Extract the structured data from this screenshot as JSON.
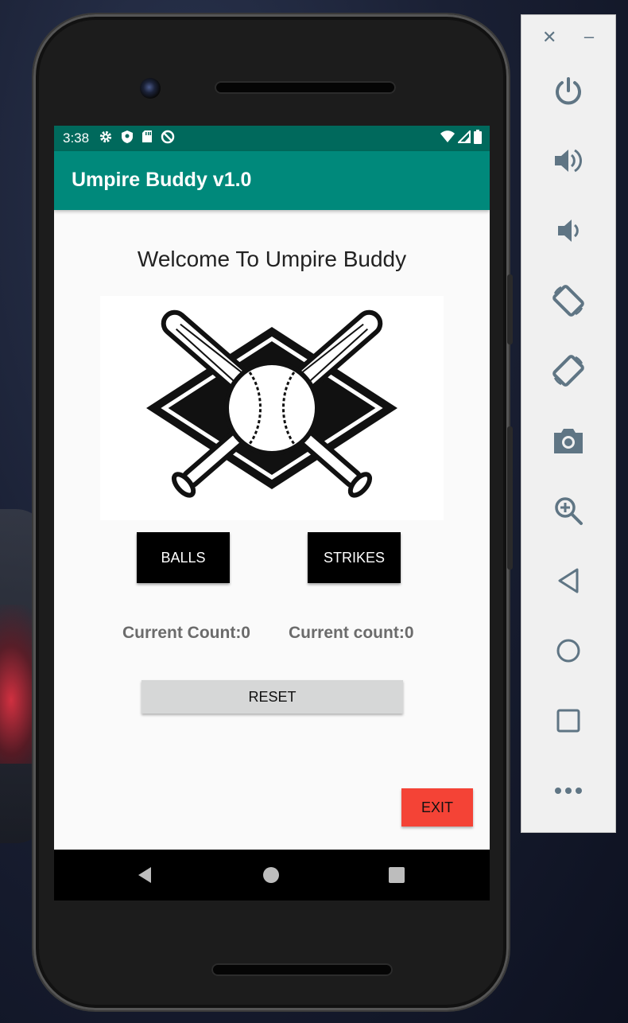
{
  "status_bar": {
    "time": "3:38"
  },
  "app_bar": {
    "title": "Umpire Buddy v1.0"
  },
  "main": {
    "welcome": "Welcome To Umpire Buddy",
    "balls_button": "BALLS",
    "strikes_button": "STRIKES",
    "balls_count": "Current Count:0",
    "strikes_count": "Current count:0",
    "reset_button": "RESET",
    "exit_button": "EXIT"
  },
  "colors": {
    "status_bar": "#00695c",
    "app_bar": "#00897b",
    "exit": "#f44336",
    "reset": "#d6d7d7",
    "toolbar_icon": "#5f7584"
  },
  "emulator_toolbar": {
    "icons": [
      "close-icon",
      "minimize-icon",
      "power-icon",
      "volume-up-icon",
      "volume-down-icon",
      "rotate-left-icon",
      "rotate-right-icon",
      "camera-icon",
      "zoom-icon",
      "back-icon",
      "home-icon",
      "overview-icon",
      "more-icon"
    ]
  }
}
